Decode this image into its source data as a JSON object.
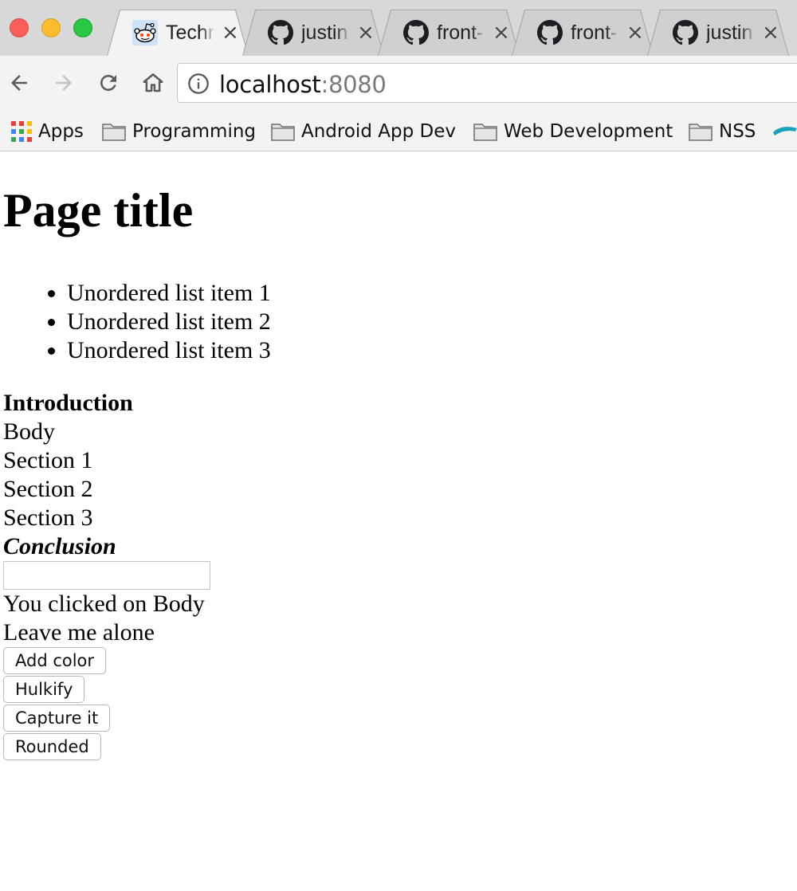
{
  "browser": {
    "tabs": [
      {
        "title": "Techr",
        "icon": "reddit-icon",
        "active": true
      },
      {
        "title": "justin",
        "icon": "github-icon",
        "active": false
      },
      {
        "title": "front-",
        "icon": "github-icon",
        "active": false
      },
      {
        "title": "front-",
        "icon": "github-icon",
        "active": false
      },
      {
        "title": "justin",
        "icon": "github-icon",
        "active": false
      }
    ],
    "close_glyph": "×",
    "address": {
      "host": "localhost",
      "port": ":8080"
    },
    "bookmarks": [
      {
        "label": "Apps",
        "icon": "apps-grid-icon"
      },
      {
        "label": "Programming",
        "icon": "folder-icon"
      },
      {
        "label": "Android App Dev",
        "icon": "folder-icon"
      },
      {
        "label": "Web Development",
        "icon": "folder-icon"
      },
      {
        "label": "NSS",
        "icon": "folder-icon"
      }
    ]
  },
  "page": {
    "title": "Page title",
    "list_items": [
      "Unordered list item 1",
      "Unordered list item 2",
      "Unordered list item 3"
    ],
    "introduction": "Introduction",
    "body": "Body",
    "sections": [
      "Section 1",
      "Section 2",
      "Section 3"
    ],
    "conclusion": "Conclusion",
    "text_input_value": "",
    "status_message": "You clicked on Body",
    "leave_message": "Leave me alone",
    "buttons": {
      "add_color": "Add color",
      "hulkify": "Hulkify",
      "capture": "Capture it",
      "rounded": "Rounded"
    }
  }
}
